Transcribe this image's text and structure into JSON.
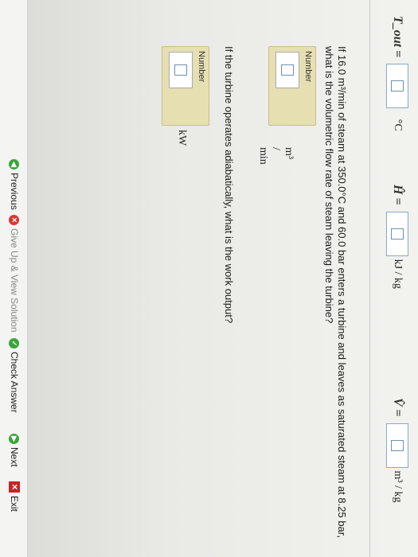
{
  "equations": [
    {
      "symbol": "T_out =",
      "unit": "°C"
    },
    {
      "symbol": "Ĥ =",
      "unit": "kJ / kg"
    },
    {
      "symbol": "V̂ =",
      "unit": "m³ / kg"
    }
  ],
  "question1": {
    "text_line1": "If 16.0 m³/min of steam at 350.0°C and 60.0 bar enters a turbine and leaves as saturated steam at 8.25 bar,",
    "text_line2": "what is the volumetric flow rate of steam leaving the turbine?",
    "number_label": "Number",
    "value": "",
    "unit": "m³ / min"
  },
  "question2": {
    "text": "If the turbine operates adiabatically, what is the work output?",
    "number_label": "Number",
    "value": "",
    "unit": "kW"
  },
  "nav": {
    "previous": "Previous",
    "give_up": "Give Up & View Solution",
    "check_answer": "Check Answer",
    "next": "Next",
    "exit": "Exit"
  }
}
